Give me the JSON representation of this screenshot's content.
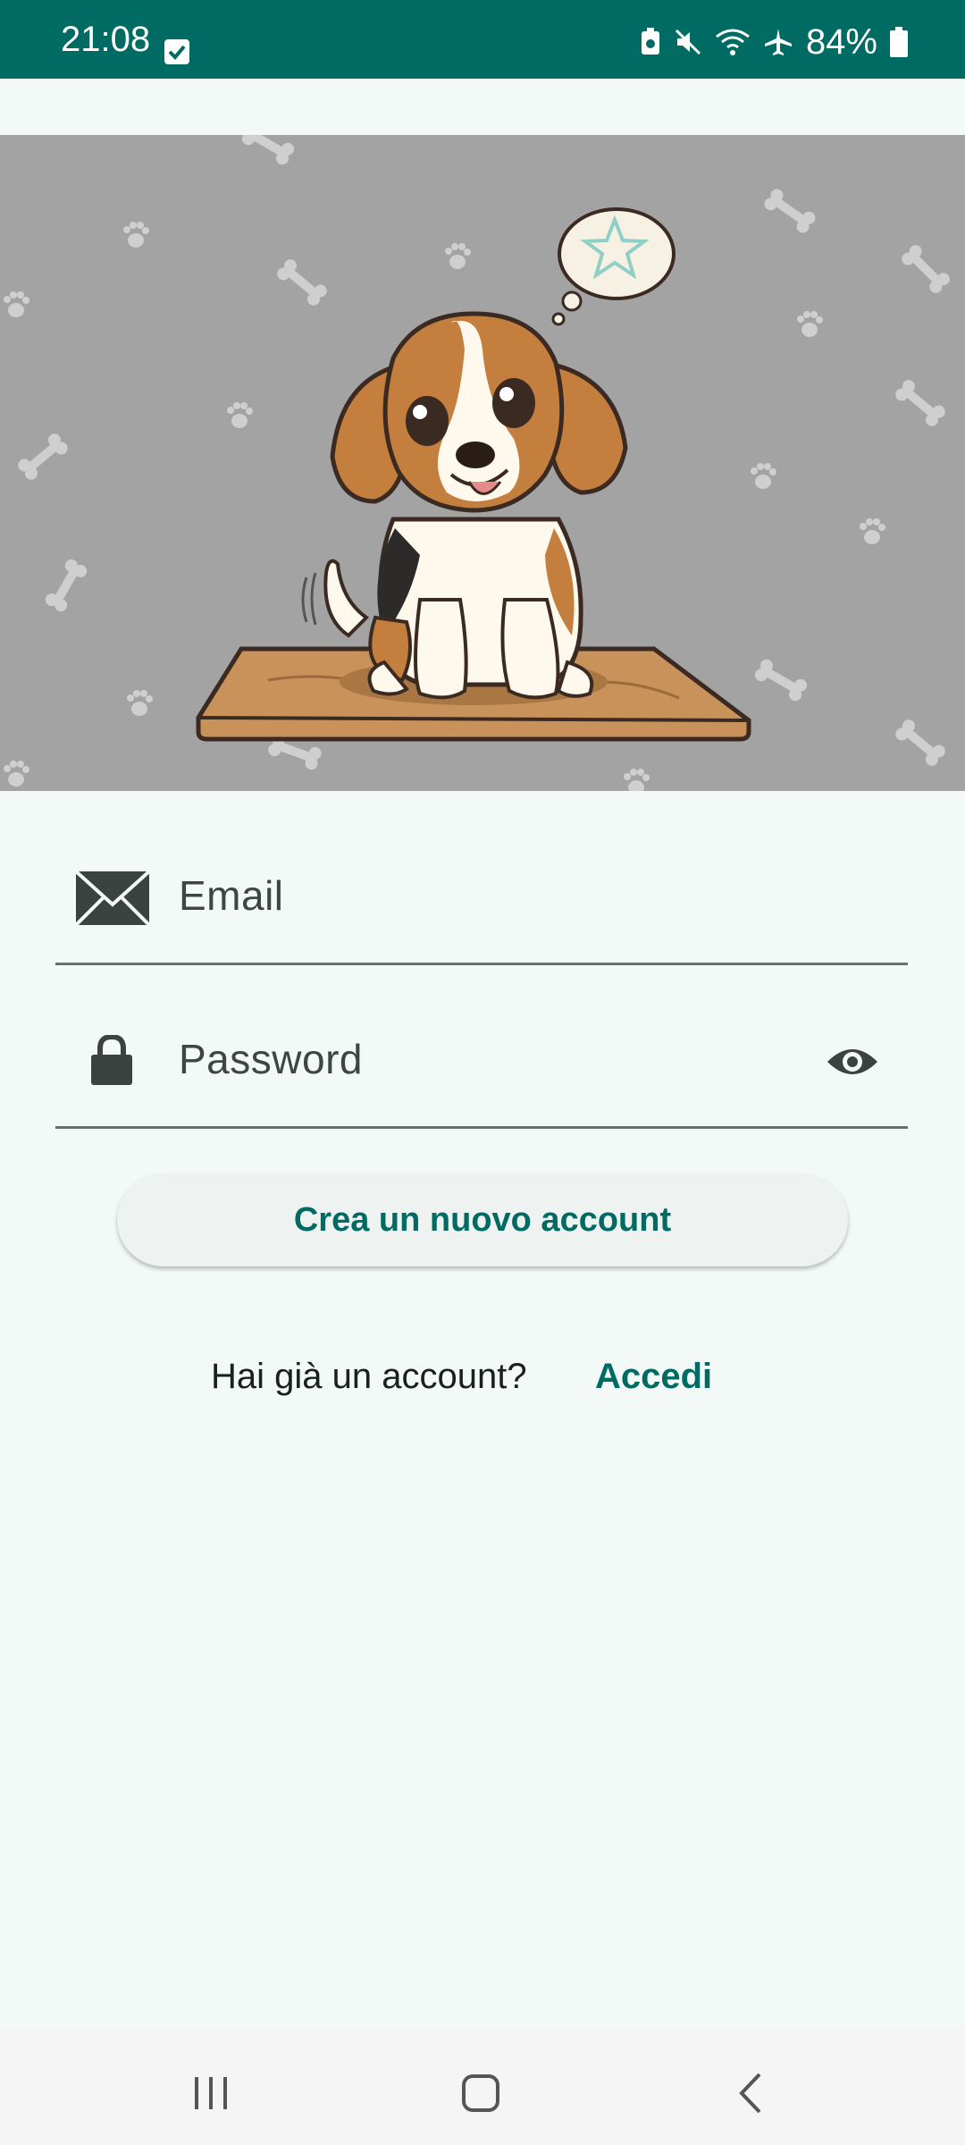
{
  "status_bar": {
    "time": "21:08",
    "battery_percent": "84%",
    "icons": [
      "checkbox-notification-icon",
      "battery-saver-icon",
      "mute-icon",
      "wifi-icon",
      "airplane-icon",
      "battery-icon"
    ]
  },
  "hero": {
    "image": "beagle-puppy-illustration"
  },
  "form": {
    "email_placeholder": "Email",
    "password_placeholder": "Password",
    "create_account_label": "Crea un nuovo account",
    "already_have_account": "Hai già un account?",
    "login_link": "Accedi"
  },
  "colors": {
    "primary": "#006b63",
    "background": "#f3f9f7",
    "hero_bg": "#a3a3a3"
  },
  "nav_bar": {
    "buttons": [
      "recents-icon",
      "home-icon",
      "back-icon"
    ]
  }
}
